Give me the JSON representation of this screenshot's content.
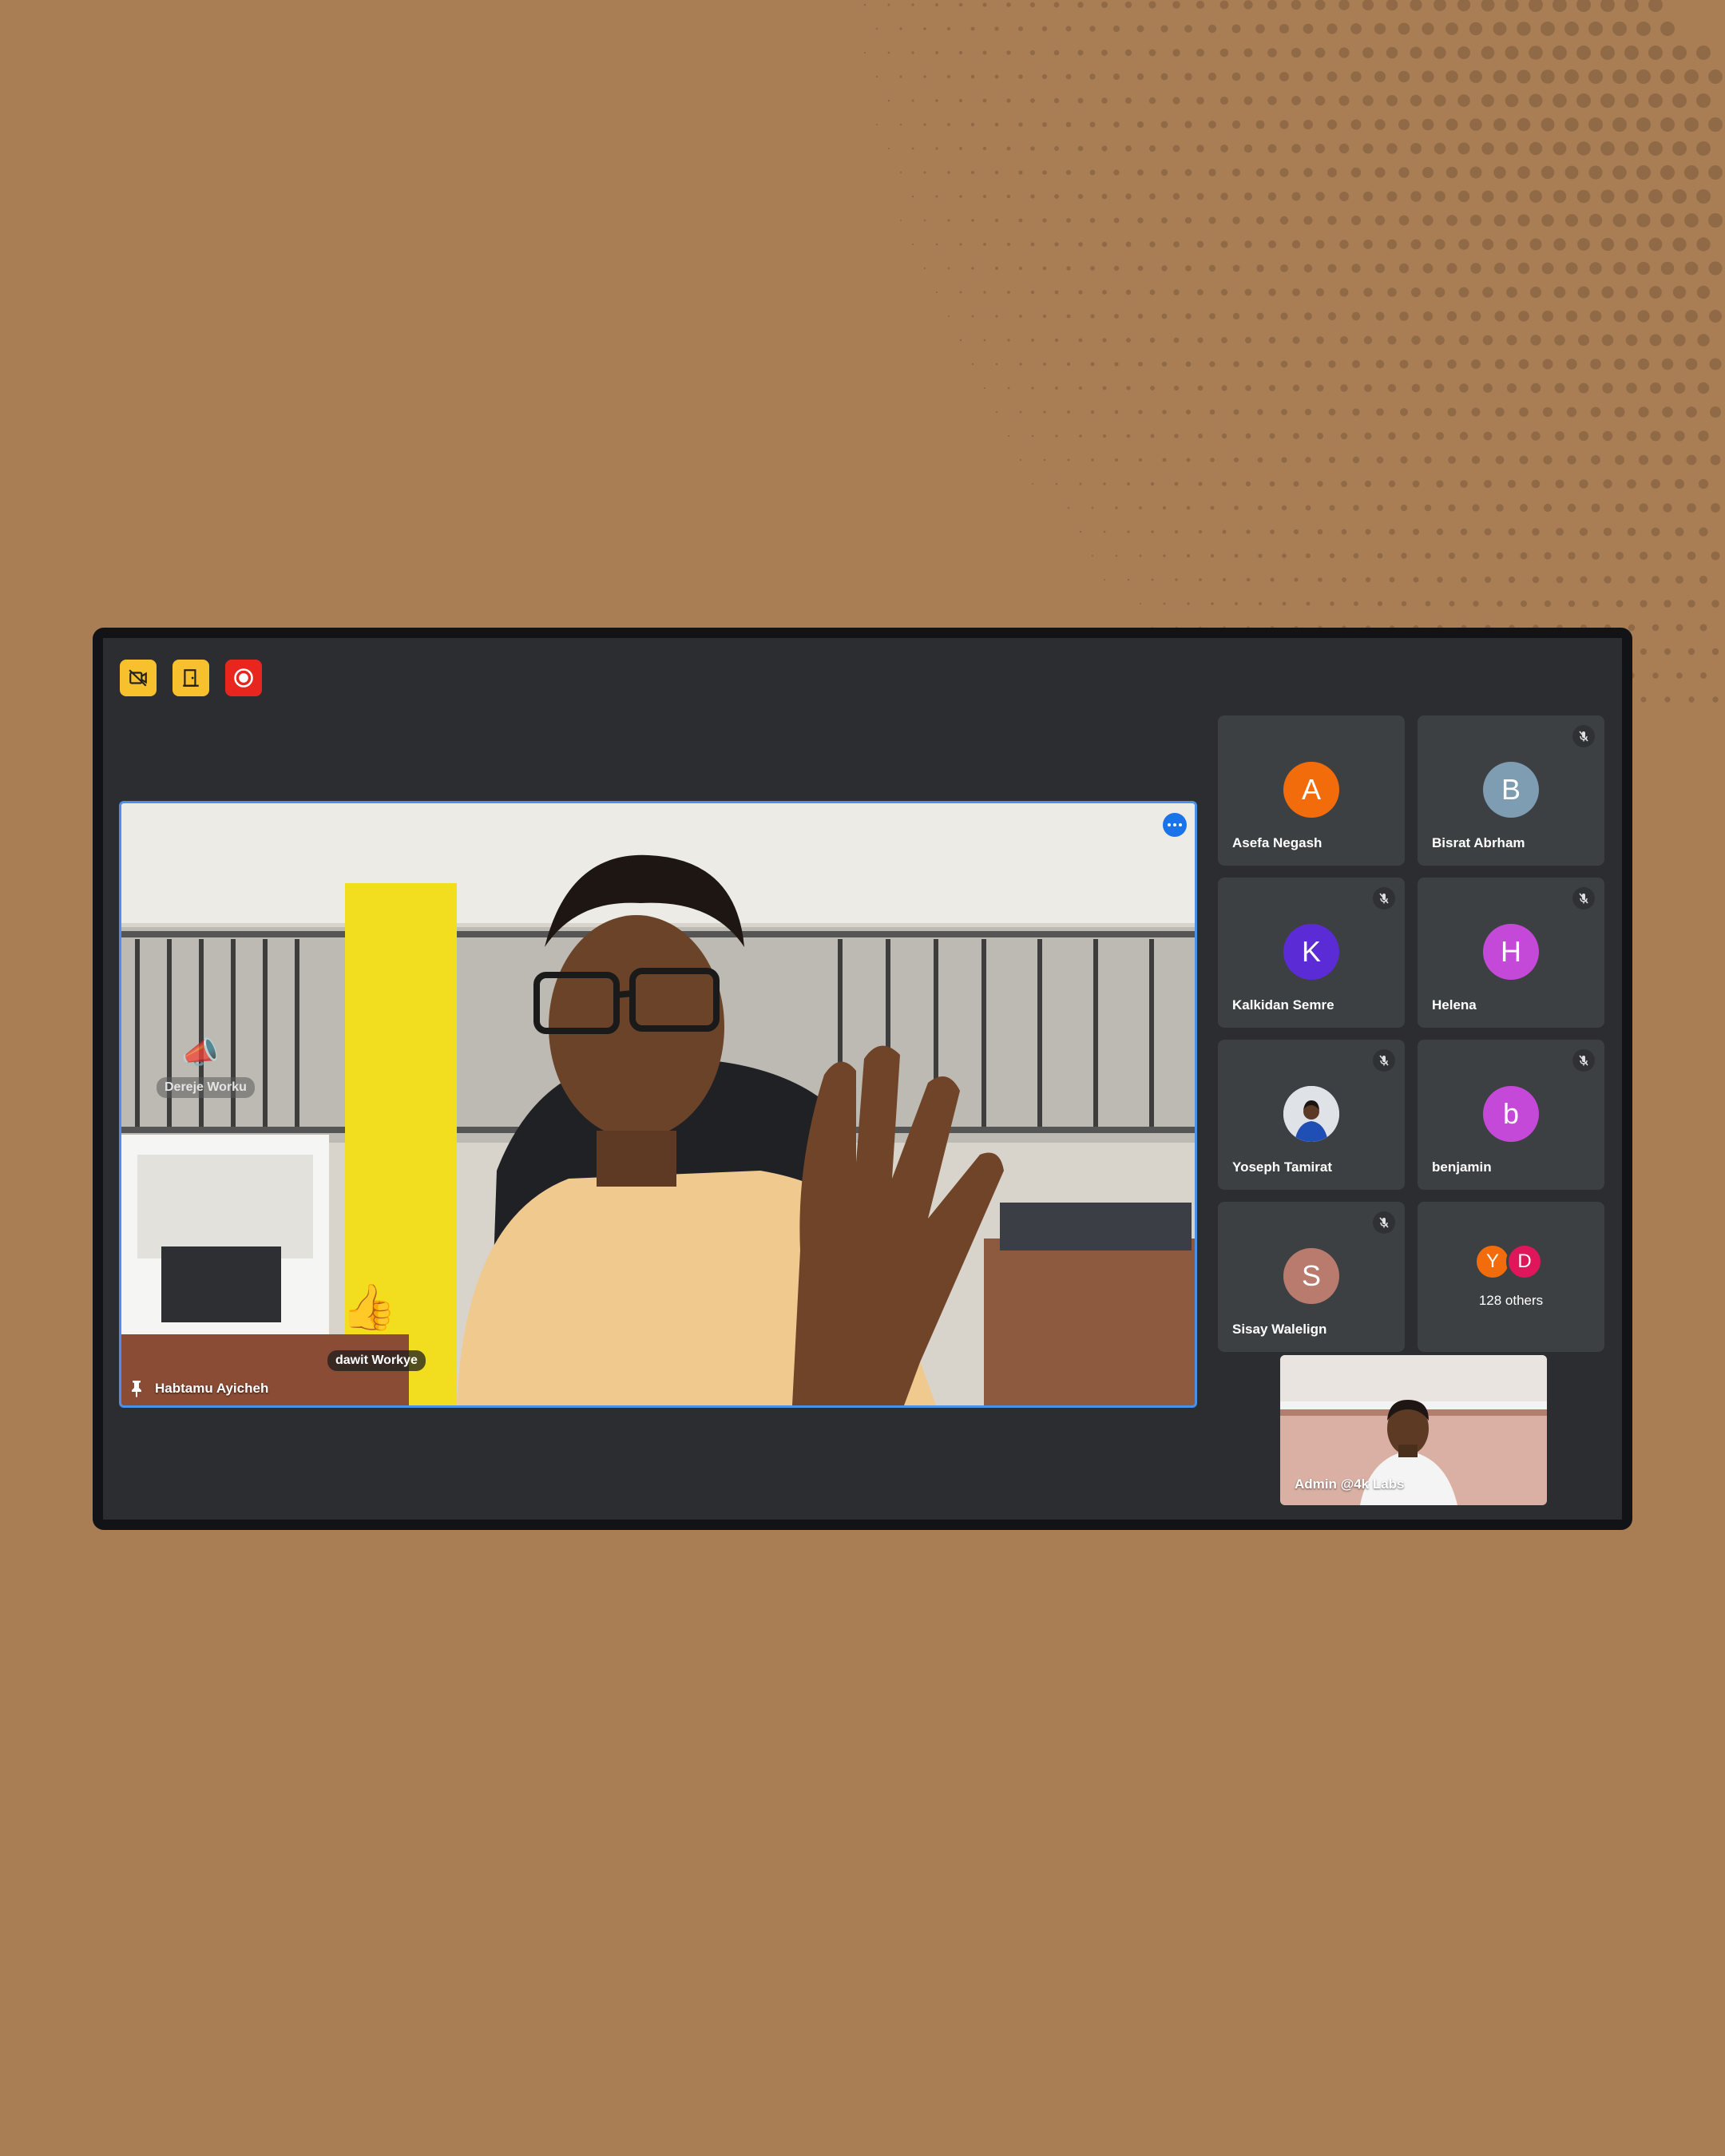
{
  "toolbar": {
    "buttons": [
      {
        "icon": "camera-off-icon",
        "color": "#f6c12c"
      },
      {
        "icon": "door-exit-icon",
        "color": "#f6c12c"
      },
      {
        "icon": "record-icon",
        "color": "#e8261f"
      }
    ]
  },
  "main_video": {
    "pinned_name": "Habtamu Ayicheh",
    "reaction_names": [
      "Dereje Worku",
      "dawit Workye"
    ],
    "reaction_emojis": [
      "📣",
      "👍"
    ],
    "border_color": "#4c8fea"
  },
  "participants": [
    {
      "name": "Asefa Negash",
      "initial": "A",
      "color": "#f36c0b",
      "muted": false
    },
    {
      "name": "Bisrat Abrham",
      "initial": "B",
      "color": "#7e9cb2",
      "muted": true
    },
    {
      "name": "Kalkidan Semre",
      "initial": "K",
      "color": "#5b2bd6",
      "muted": true
    },
    {
      "name": "Helena",
      "initial": "H",
      "color": "#c549d8",
      "muted": true
    },
    {
      "name": "Yoseph Tamirat",
      "initial": "",
      "color": "#d9dde2",
      "muted": true
    },
    {
      "name": "benjamin",
      "initial": "b",
      "color": "#c549d8",
      "muted": true
    },
    {
      "name": "Sisay Walelign",
      "initial": "S",
      "color": "#b87b6e",
      "muted": true
    }
  ],
  "others": {
    "label": "128 others",
    "avatars": [
      {
        "initial": "Y",
        "color": "#f36c0b"
      },
      {
        "initial": "D",
        "color": "#e0165a"
      }
    ]
  },
  "self_view": {
    "label": "Admin @4k Labs"
  }
}
